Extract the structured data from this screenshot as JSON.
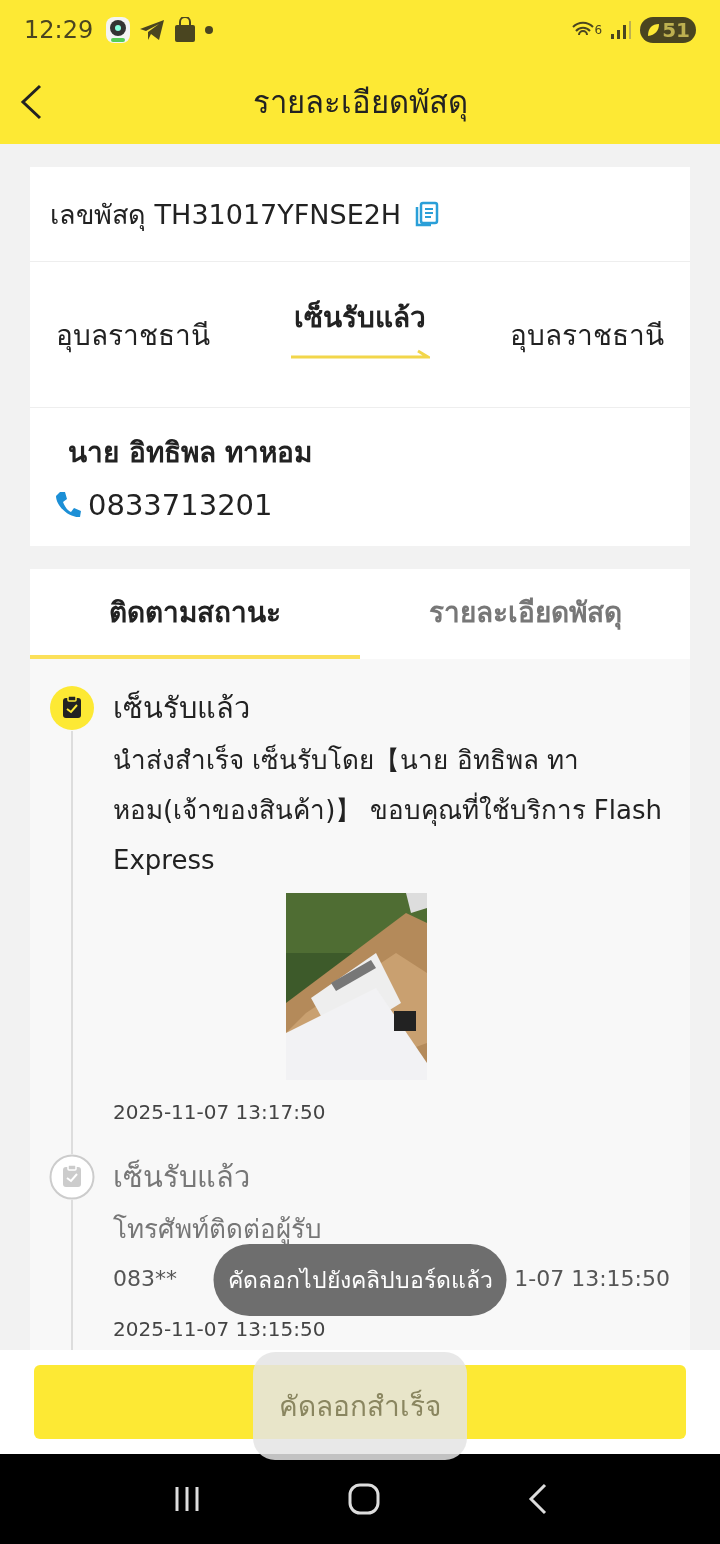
{
  "status_bar": {
    "time": "12:29",
    "network": "6",
    "battery": "51"
  },
  "header": {
    "title": "รายละเอียดพัสดุ"
  },
  "parcel": {
    "label": "เลขพัสดุ TH31017YFNSE2H"
  },
  "route": {
    "from": "อุบลราชธานี",
    "status": "เซ็นรับแล้ว",
    "to": "อุบลราชธานี"
  },
  "recipient": {
    "name": "นาย อิทธิพล ทาหอม",
    "phone": "0833713201"
  },
  "tabs": [
    {
      "label": "ติดตามสถานะ",
      "selected": true
    },
    {
      "label": "รายละเอียดพัสดุ",
      "selected": false
    }
  ],
  "events": [
    {
      "title": "เซ็นรับแล้ว",
      "latest": true,
      "description": "นำส่งสำเร็จ เซ็นรับโดย【นาย อิทธิพล ทาหอม(เจ้าของสินค้า)】 ขอบคุณที่ใช้บริการ Flash Express",
      "time": "2025-11-07 13:17:50"
    },
    {
      "title": "เซ็นรับแล้ว",
      "latest": false,
      "description": "โทรศัพท์ติดต่อผู้รับ",
      "note_start": "083**",
      "note_end": "1-07 13:15:50",
      "time": "2025-11-07 13:15:50"
    }
  ],
  "toasts": [
    {
      "text": "คัดลอกไปยังคลิปบอร์ดแล้ว"
    },
    {
      "text": "คัดลอกสำเร็จ"
    }
  ]
}
